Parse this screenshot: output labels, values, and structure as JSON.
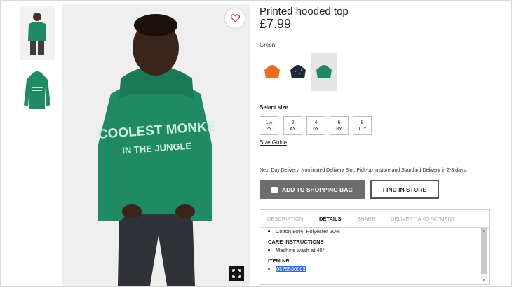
{
  "product": {
    "title": "Printed hooded top",
    "price": "£7.99",
    "color_name": "Green",
    "swatches": [
      {
        "name": "orange",
        "color": "#ee6a1f"
      },
      {
        "name": "navy-print",
        "color": "#1d2a3a"
      },
      {
        "name": "green",
        "color": "#1f8a63"
      }
    ],
    "hoodie_print_line1": "COOLEST MONKE",
    "hoodie_print_line2": "IN THE JUNGLE"
  },
  "sizes": {
    "title": "Select size",
    "options": [
      {
        "top": "1½",
        "bottom": "2Y"
      },
      {
        "top": "2",
        "bottom": "4Y"
      },
      {
        "top": "4",
        "bottom": "6Y"
      },
      {
        "top": "6",
        "bottom": "8Y"
      },
      {
        "top": "8",
        "bottom": "10Y"
      }
    ],
    "guide_label": "Size Guide"
  },
  "delivery_text": "Next Day Delivery, Nominated Delivery Slot, Pick-up in store and Standard Delivery in 2-3 days.",
  "actions": {
    "add_to_bag": "ADD TO SHOPPING BAG",
    "find_in_store": "FIND IN STORE"
  },
  "tabs": [
    {
      "label": "DESCRIPTION",
      "active": false
    },
    {
      "label": "DETAILS",
      "active": true
    },
    {
      "label": "SHARE",
      "active": false
    },
    {
      "label": "DELIVERY AND PAYMENT",
      "active": false
    }
  ],
  "details": {
    "composition": "Cotton 80%; Polyester 20%",
    "care_heading": "CARE INSTRUCTIONS",
    "care_item": "Machine wash at 40°",
    "item_heading": "ITEM NR.",
    "item_number": "0575530003"
  },
  "colors": {
    "hoodie_green": "#1f8a63",
    "button_grey": "#6d6d6d",
    "selection_blue": "#2e6cd6"
  }
}
